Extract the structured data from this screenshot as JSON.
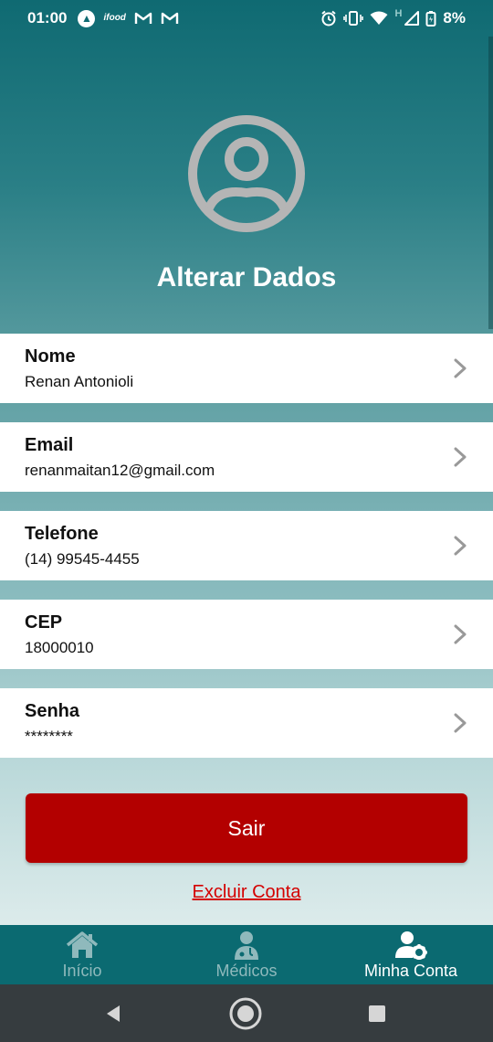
{
  "status_bar": {
    "time": "01:00",
    "battery": "8%",
    "network_letter": "H",
    "left_icons": [
      "navigation-icon",
      "ifood-icon",
      "gmail-icon",
      "gmail-icon"
    ],
    "right_icons": [
      "alarm-icon",
      "vibrate-icon",
      "wifi-icon",
      "signal-icon",
      "battery-icon"
    ]
  },
  "header": {
    "title": "Alterar Dados",
    "avatar_icon": "user-avatar-icon"
  },
  "fields": [
    {
      "label": "Nome",
      "value": "Renan Antonioli"
    },
    {
      "label": "Email",
      "value": "renanmaitan12@gmail.com"
    },
    {
      "label": "Telefone",
      "value": "(14) 99545-4455"
    },
    {
      "label": "CEP",
      "value": "18000010"
    },
    {
      "label": "Senha",
      "value": "********"
    }
  ],
  "actions": {
    "logout_label": "Sair",
    "delete_label": "Excluir Conta"
  },
  "bottom_nav": {
    "items": [
      {
        "label": "Início",
        "icon": "home-icon",
        "active": false
      },
      {
        "label": "Médicos",
        "icon": "doctor-icon",
        "active": false
      },
      {
        "label": "Minha Conta",
        "icon": "user-settings-icon",
        "active": true
      }
    ]
  },
  "colors": {
    "primary": "#0b6a71",
    "danger": "#b30000",
    "link_danger": "#d40000"
  }
}
